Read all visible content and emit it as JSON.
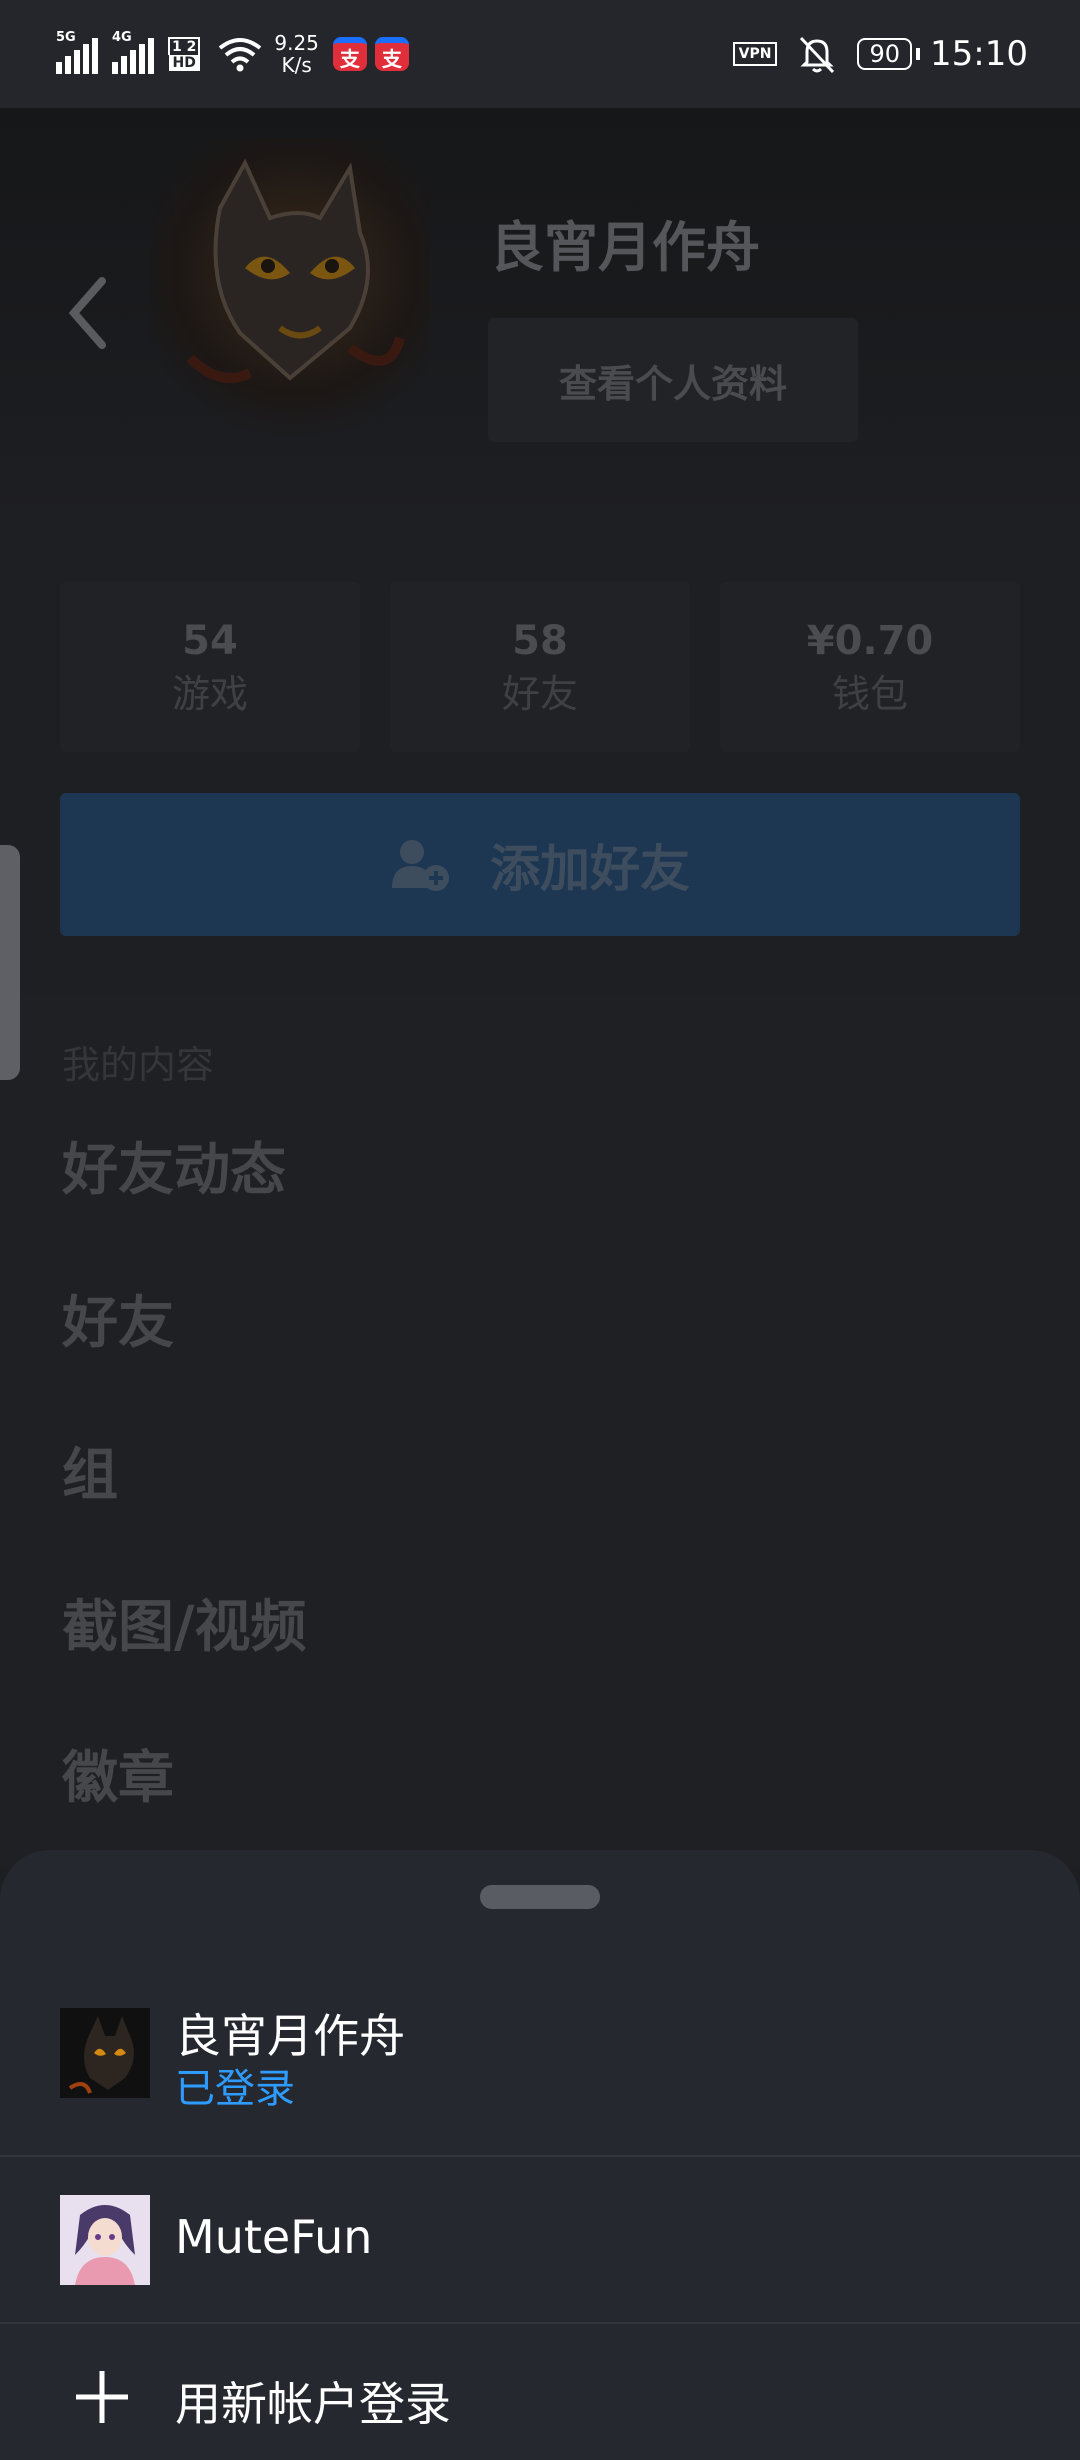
{
  "status_bar": {
    "network_1": "5G",
    "network_2": "4G",
    "hd_top": "1 2",
    "hd_bottom": "HD",
    "speed_value": "9.25",
    "speed_unit": "K/s",
    "app_icon_1": "支",
    "app_icon_2": "支",
    "vpn": "VPN",
    "battery": "90",
    "time": "15:10"
  },
  "profile": {
    "username": "良宵月作舟",
    "view_profile_label": "查看个人资料"
  },
  "stats": [
    {
      "value": "54",
      "label": "游戏"
    },
    {
      "value": "58",
      "label": "好友"
    },
    {
      "value": "¥0.70",
      "label": "钱包"
    }
  ],
  "add_friend_label": "添加好友",
  "my_content": {
    "title": "我的内容",
    "items": [
      "好友动态",
      "好友",
      "组",
      "截图/视频",
      "徽章"
    ]
  },
  "account_sheet": {
    "accounts": [
      {
        "name": "良宵月作舟",
        "status": "已登录"
      },
      {
        "name": "MuteFun",
        "status": ""
      }
    ],
    "new_account_label": "用新帐户登录"
  },
  "colors": {
    "background": "#1e1f23",
    "sheet": "#262830",
    "accent_blue": "#2e9bff",
    "add_friend_bg": "#1d3652"
  },
  "icons": [
    "back-chevron-icon",
    "add-user-icon",
    "plus-icon",
    "wifi-icon",
    "mute-bell-icon"
  ]
}
